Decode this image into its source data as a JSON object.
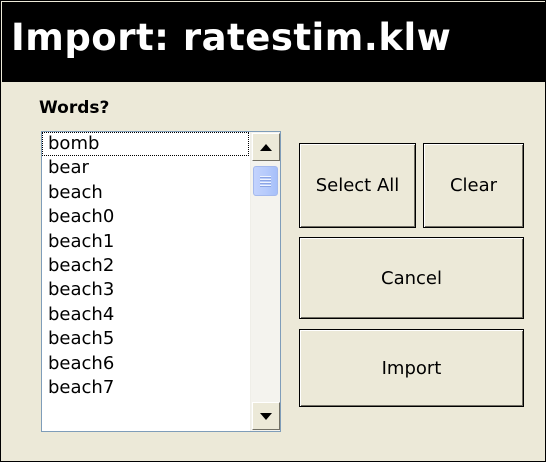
{
  "window": {
    "title": "Import: ratestim.klw"
  },
  "words": {
    "label": "Words?",
    "items": [
      "bomb",
      "bear",
      "beach",
      "beach0",
      "beach1",
      "beach2",
      "beach3",
      "beach4",
      "beach5",
      "beach6",
      "beach7"
    ],
    "focused_index": 0
  },
  "buttons": {
    "select_all": "Select All",
    "clear": "Clear",
    "cancel": "Cancel",
    "import": "Import"
  },
  "icons": {
    "scroll_up": "triangle-up-icon",
    "scroll_down": "triangle-down-icon"
  },
  "colors": {
    "titlebar_bg": "#000000",
    "titlebar_text": "#ffffff",
    "dialog_bg": "#ece9d8",
    "scroll_thumb": "#b7cbfc"
  }
}
